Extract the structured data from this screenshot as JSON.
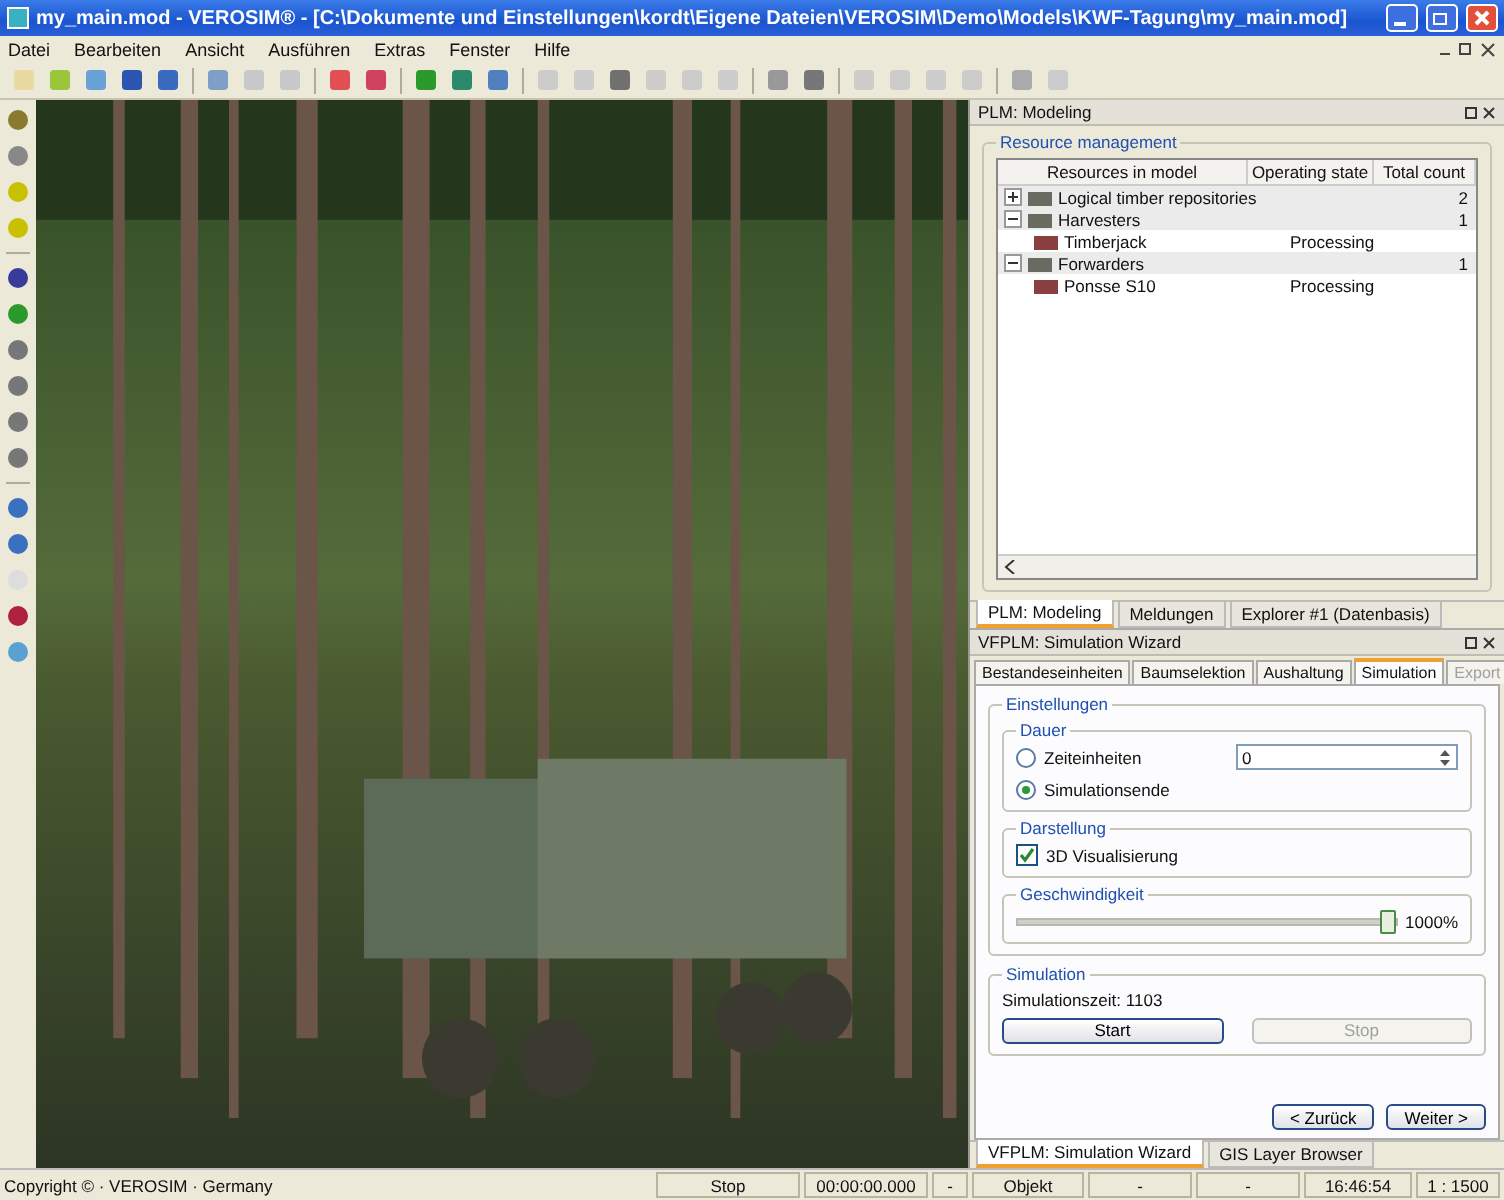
{
  "window": {
    "title": "my_main.mod - VEROSIM® - [C:\\Dokumente und Einstellungen\\kordt\\Eigene Dateien\\VEROSIM\\Demo\\Models\\KWF-Tagung\\my_main.mod]"
  },
  "menu": [
    "Datei",
    "Bearbeiten",
    "Ansicht",
    "Ausführen",
    "Extras",
    "Fenster",
    "Hilfe"
  ],
  "modeling_panel": {
    "title": "PLM: Modeling",
    "group": "Resource management",
    "columns": [
      "Resources in model",
      "Operating state",
      "Total count"
    ],
    "tree": [
      {
        "name": "Logical timber repositories",
        "count": "2",
        "expanded": false
      },
      {
        "name": "Harvesters",
        "count": "1",
        "expanded": true,
        "children": [
          {
            "name": "Timberjack",
            "state": "Processing"
          }
        ]
      },
      {
        "name": "Forwarders",
        "count": "1",
        "expanded": true,
        "children": [
          {
            "name": "Ponsse S10",
            "state": "Processing"
          }
        ]
      }
    ],
    "tabs": [
      {
        "label": "PLM: Modeling",
        "selected": true
      },
      {
        "label": "Meldungen",
        "selected": false
      },
      {
        "label": "Explorer #1 (Datenbasis)",
        "selected": false
      }
    ]
  },
  "wizard_panel": {
    "title": "VFPLM: Simulation Wizard",
    "tabs": [
      {
        "label": "Bestandeseinheiten",
        "selected": false,
        "disabled": false
      },
      {
        "label": "Baumselektion",
        "selected": false,
        "disabled": false
      },
      {
        "label": "Aushaltung",
        "selected": false,
        "disabled": false
      },
      {
        "label": "Simulation",
        "selected": true,
        "disabled": false
      },
      {
        "label": "Export",
        "selected": false,
        "disabled": true
      }
    ],
    "settings_group": "Einstellungen",
    "duration_group": "Dauer",
    "duration_options": [
      {
        "label": "Zeiteinheiten",
        "selected": false
      },
      {
        "label": "Simulationsende",
        "selected": true
      }
    ],
    "time_units_value": "0",
    "display_group": "Darstellung",
    "visualization": {
      "label": "3D Visualisierung",
      "checked": true
    },
    "speed_group": "Geschwindigkeit",
    "speed": {
      "level": 0.97,
      "reading": "1000%"
    },
    "simulation_group": "Simulation",
    "simulation_time": "Simulationszeit:  1103",
    "buttons": [
      {
        "label": "Start",
        "disabled": false
      },
      {
        "label": "Stop",
        "disabled": true
      }
    ],
    "nav_buttons": [
      "< Zurück",
      "Weiter >"
    ],
    "bottom_tabs": [
      {
        "label": "VFPLM: Simulation Wizard",
        "selected": true
      },
      {
        "label": "GIS Layer Browser",
        "selected": false
      }
    ]
  },
  "status_bar": {
    "copyright": "Copyright © · VEROSIM · Germany",
    "cells": [
      "Stop",
      "00:00:00.000",
      "-",
      "Objekt",
      "-",
      "-",
      "16:46:54",
      "1 : 1500"
    ]
  }
}
